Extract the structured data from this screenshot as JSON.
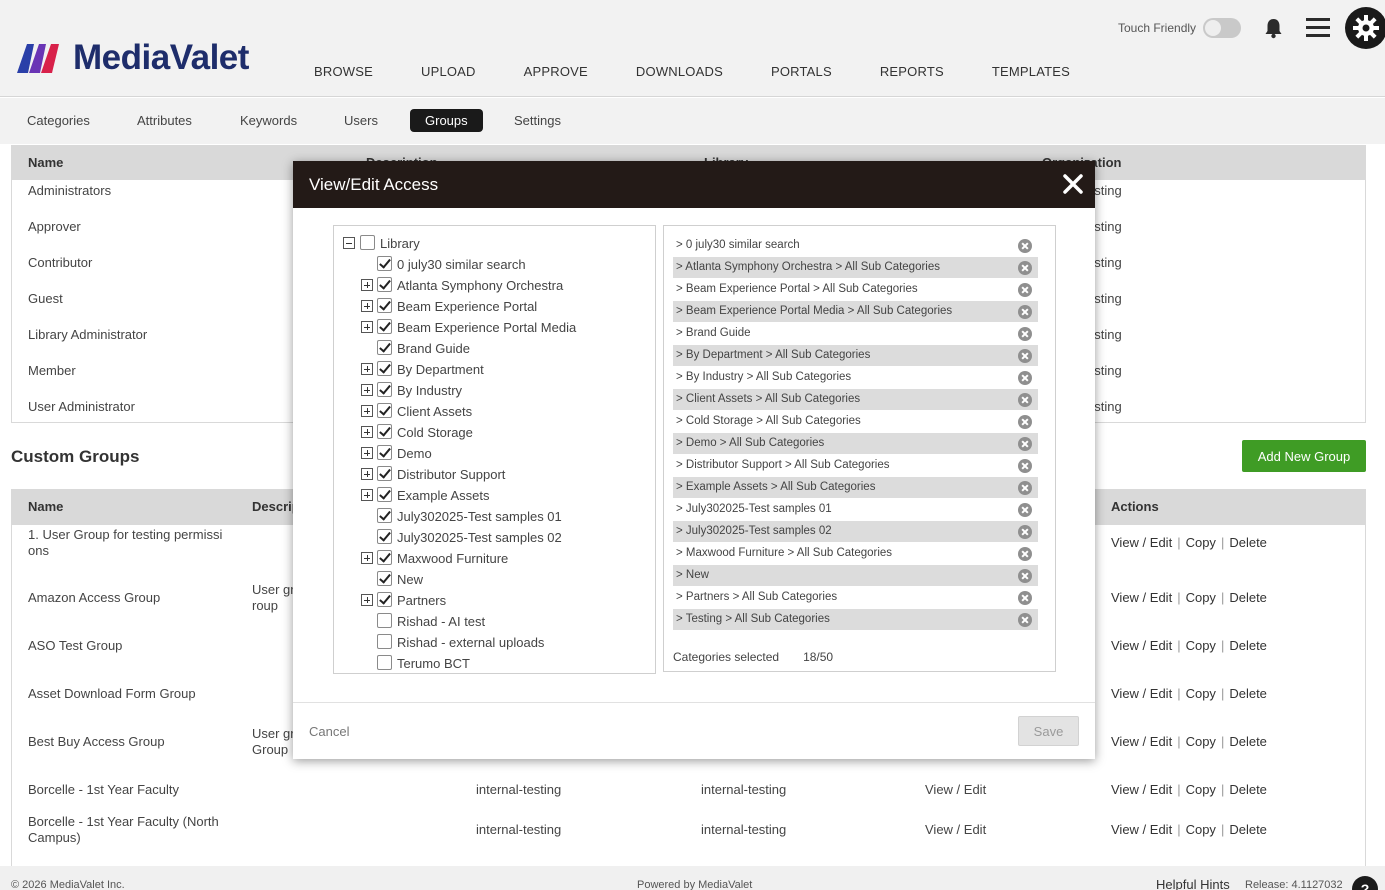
{
  "header": {
    "logo_text": "MediaValet",
    "nav": [
      "BROWSE",
      "UPLOAD",
      "APPROVE",
      "DOWNLOADS",
      "PORTALS",
      "REPORTS",
      "TEMPLATES"
    ],
    "touch_label": "Touch Friendly"
  },
  "subnav": {
    "items": [
      "Categories",
      "Attributes",
      "Keywords",
      "Users",
      "Groups",
      "Settings"
    ],
    "active": "Groups"
  },
  "system_groups": {
    "columns": [
      "Name",
      "Description",
      "Library",
      "Organization"
    ],
    "rows": [
      {
        "name": "Administrators",
        "org": "esting"
      },
      {
        "name": "Approver",
        "org": "esting"
      },
      {
        "name": "Contributor",
        "org": "esting"
      },
      {
        "name": "Guest",
        "org": "esting"
      },
      {
        "name": "Library Administrator",
        "org": "esting"
      },
      {
        "name": "Member",
        "org": "esting"
      },
      {
        "name": "User Administrator",
        "org": "esting"
      }
    ]
  },
  "custom_groups": {
    "title": "Custom Groups",
    "add_button": "Add New Group",
    "columns": [
      "Name",
      "Descrip",
      "Actions"
    ],
    "action_labels": {
      "edit": "View / Edit",
      "copy": "Copy",
      "delete": "Delete"
    },
    "rows": [
      {
        "name": "1. User Group for testing permissi ons",
        "desc": "",
        "desc2": "",
        "lib": "",
        "org": "",
        "access": ""
      },
      {
        "name": "Amazon Access Group",
        "desc": "User gr",
        "desc2": "roup",
        "lib": "",
        "org": "",
        "access": ""
      },
      {
        "name": "ASO Test Group",
        "desc": "",
        "desc2": "",
        "lib": "",
        "org": "",
        "access": ""
      },
      {
        "name": "Asset Download Form Group",
        "desc": "",
        "desc2": "",
        "lib": "",
        "org": "",
        "access": ""
      },
      {
        "name": "Best Buy Access Group",
        "desc": "User gr",
        "desc2": "Group",
        "lib": "",
        "org": "",
        "access": ""
      },
      {
        "name": "Borcelle - 1st Year Faculty",
        "desc": "",
        "desc2": "",
        "lib": "internal-testing",
        "org": "internal-testing",
        "access": "View / Edit"
      },
      {
        "name": "Borcelle - 1st Year Faculty (North Campus)",
        "desc": "",
        "desc2": "",
        "lib": "internal-testing",
        "org": "internal-testing",
        "access": "View / Edit"
      }
    ]
  },
  "footer": {
    "copyright": "© 2026 MediaValet Inc.",
    "powered": "Powered by MediaValet",
    "hints": "Helpful Hints",
    "release": "Release: 4.1127032",
    "help": "?"
  },
  "modal": {
    "title": "View/Edit Access",
    "tree_root": "Library",
    "tree": [
      {
        "label": "0 july30 similar search",
        "checked": true,
        "expandable": false
      },
      {
        "label": "Atlanta Symphony Orchestra",
        "checked": true,
        "expandable": true
      },
      {
        "label": "Beam Experience Portal",
        "checked": true,
        "expandable": true
      },
      {
        "label": "Beam Experience Portal Media",
        "checked": true,
        "expandable": true
      },
      {
        "label": "Brand Guide",
        "checked": true,
        "expandable": false
      },
      {
        "label": "By Department",
        "checked": true,
        "expandable": true
      },
      {
        "label": "By Industry",
        "checked": true,
        "expandable": true
      },
      {
        "label": "Client Assets",
        "checked": true,
        "expandable": true
      },
      {
        "label": "Cold Storage",
        "checked": true,
        "expandable": true
      },
      {
        "label": "Demo",
        "checked": true,
        "expandable": true
      },
      {
        "label": "Distributor Support",
        "checked": true,
        "expandable": true
      },
      {
        "label": "Example Assets",
        "checked": true,
        "expandable": true
      },
      {
        "label": "July302025-Test samples 01",
        "checked": true,
        "expandable": false
      },
      {
        "label": "July302025-Test samples 02",
        "checked": true,
        "expandable": false
      },
      {
        "label": "Maxwood Furniture",
        "checked": true,
        "expandable": true
      },
      {
        "label": "New",
        "checked": true,
        "expandable": false
      },
      {
        "label": "Partners",
        "checked": true,
        "expandable": true
      },
      {
        "label": "Rishad - AI test",
        "checked": false,
        "expandable": false
      },
      {
        "label": "Rishad - external uploads",
        "checked": false,
        "expandable": false
      },
      {
        "label": "Terumo BCT",
        "checked": false,
        "expandable": false
      }
    ],
    "selected": [
      "> 0 july30 similar search",
      "> Atlanta Symphony Orchestra > All Sub Categories",
      "> Beam Experience Portal > All Sub Categories",
      "> Beam Experience Portal Media > All Sub Categories",
      "> Brand Guide",
      "> By Department > All Sub Categories",
      "> By Industry > All Sub Categories",
      "> Client Assets > All Sub Categories",
      "> Cold Storage > All Sub Categories",
      "> Demo > All Sub Categories",
      "> Distributor Support > All Sub Categories",
      "> Example Assets > All Sub Categories",
      "> July302025-Test samples 01",
      "> July302025-Test samples 02",
      "> Maxwood Furniture > All Sub Categories",
      "> New",
      "> Partners > All Sub Categories",
      "> Testing > All Sub Categories"
    ],
    "count_label": "Categories selected",
    "count_value": "18/50",
    "cancel": "Cancel",
    "save": "Save"
  }
}
